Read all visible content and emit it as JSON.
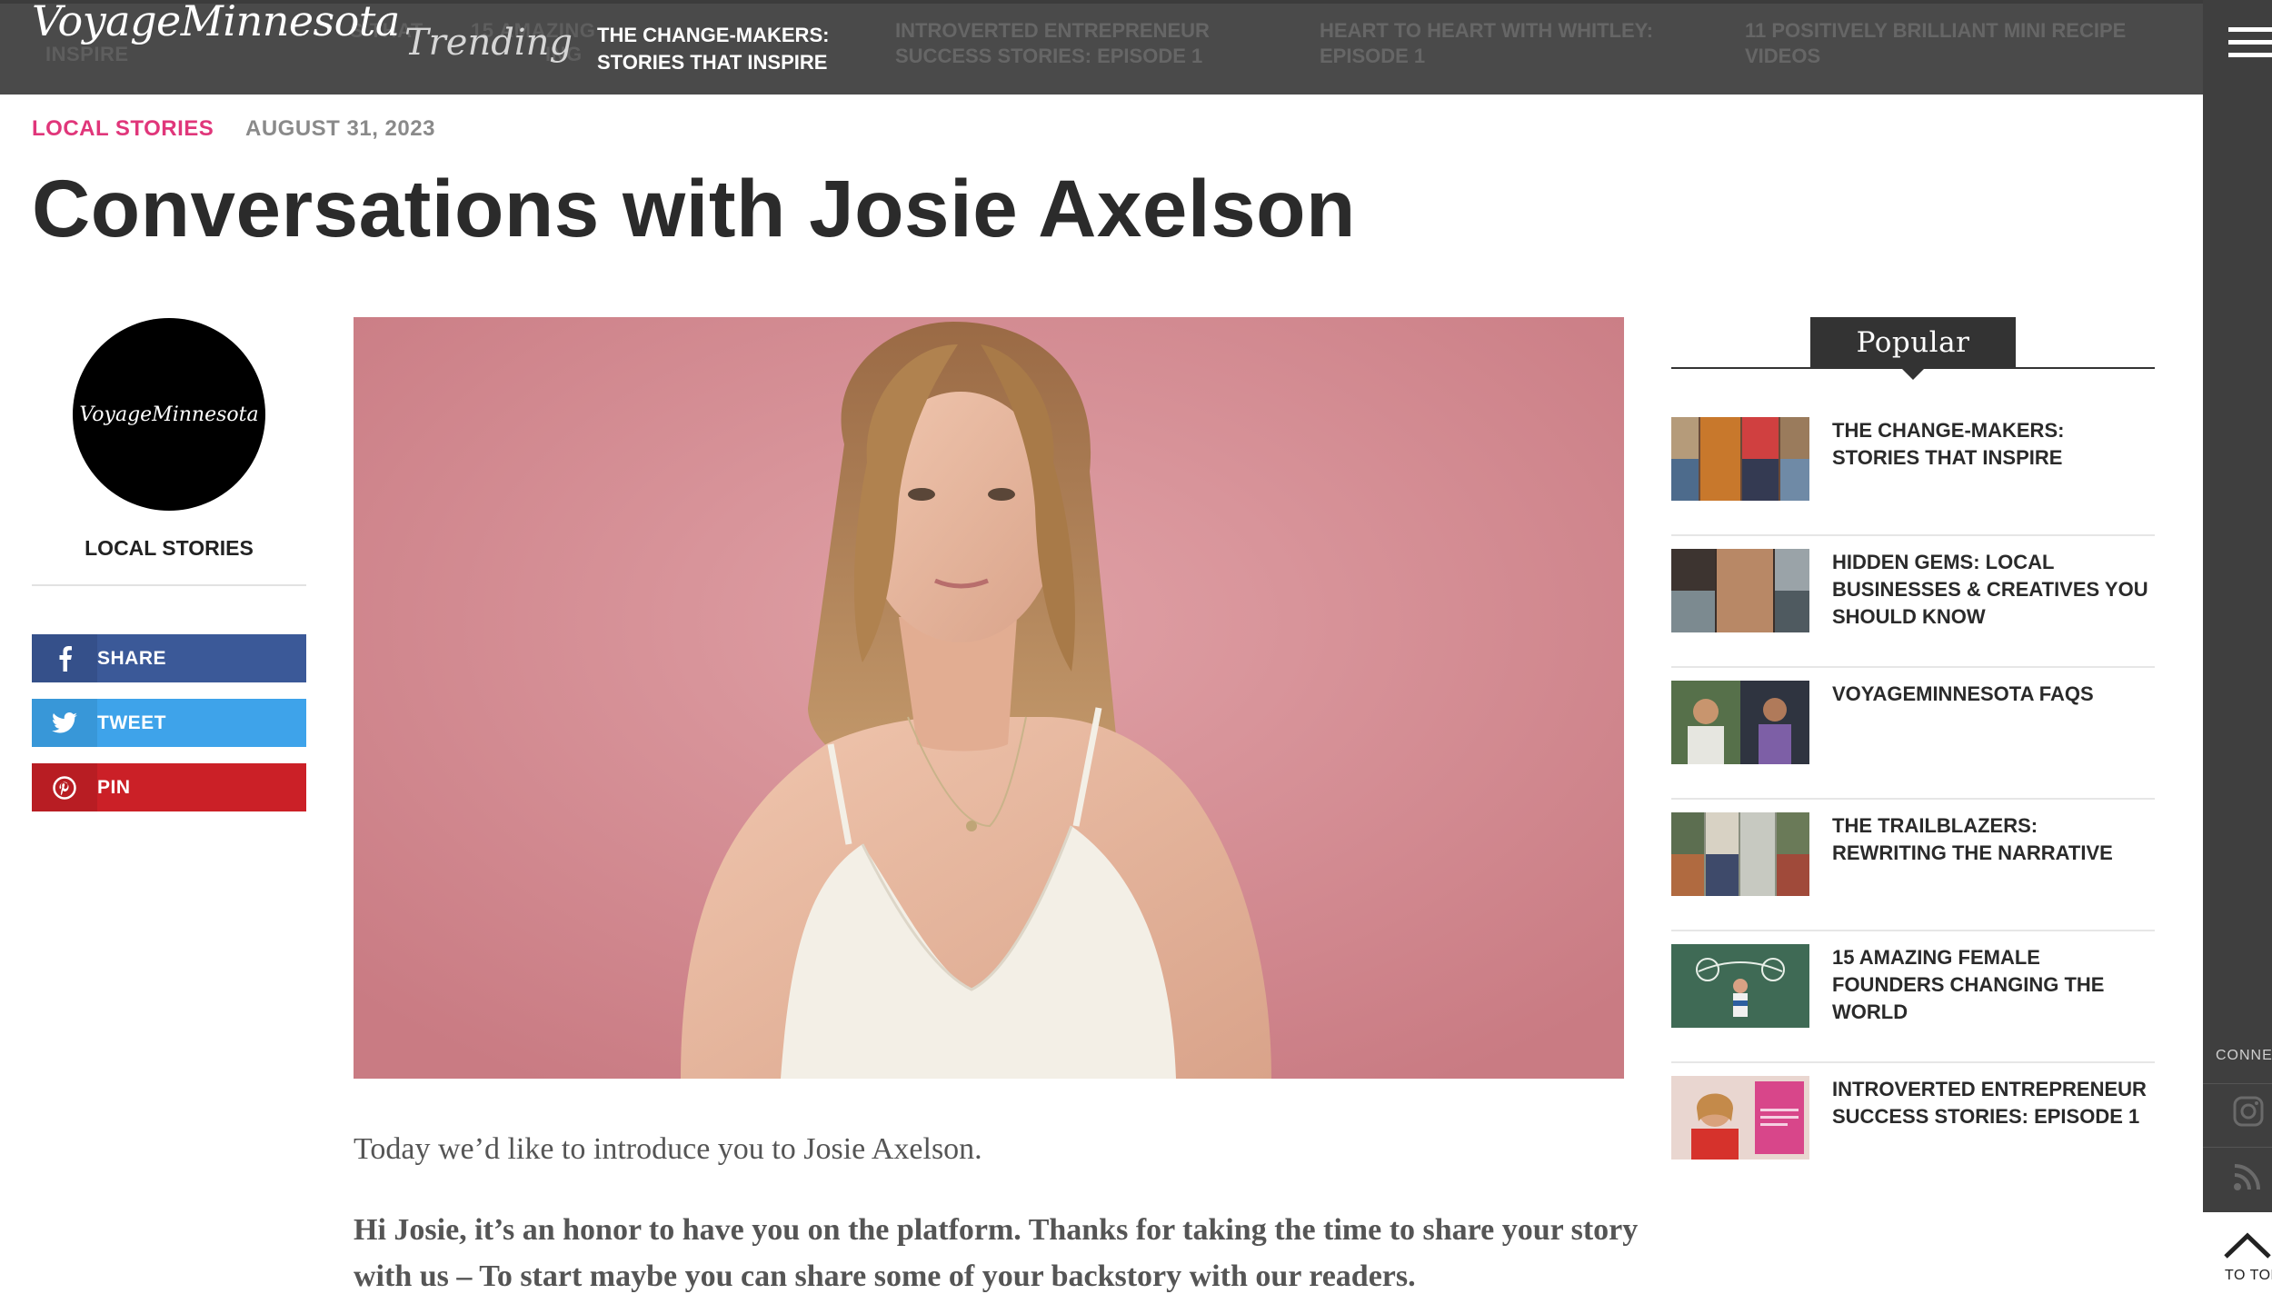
{
  "site": {
    "logo": "VoyageMinnesota",
    "trending_label": "Trending"
  },
  "ticker": {
    "active": "The Change-Makers: Stories That Inspire",
    "items": [
      "Introverted Entrepreneur Success Stories: Episode 1",
      "Heart to Heart with Whitley: Episode 1",
      "11 Positively Brilliant Mini Recipe Videos"
    ],
    "ghost_left": [
      "Inspire",
      "S That",
      "15 Amazing",
      "ing"
    ]
  },
  "article": {
    "category": "Local Stories",
    "date": "August 31, 2023",
    "title": "Conversations with Josie Axelson",
    "intro": "Today we’d like to introduce you to Josie Axelson.",
    "question": "Hi Josie, it’s an honor to have you on the platform. Thanks for taking the time to share your story with us – To start maybe you can share some of your backstory with our readers."
  },
  "author": {
    "avatar_text": "VoyageMinnesota",
    "category": "Local Stories"
  },
  "share": {
    "facebook": "Share",
    "twitter": "Tweet",
    "pinterest": "Pin"
  },
  "popular": {
    "heading": "Popular",
    "items": [
      {
        "title": "The Change-Makers: Stories That Inspire"
      },
      {
        "title": "Hidden Gems: Local Businesses & Creatives You Should Know"
      },
      {
        "title": "VoyageMinnesota FAQs"
      },
      {
        "title": "The Trailblazers: Rewriting the Narrative"
      },
      {
        "title": "15 Amazing Female Founders Changing the World"
      },
      {
        "title": "Introverted Entrepreneur Success Stories: Episode 1"
      }
    ]
  },
  "rail": {
    "connect": "CONNECT",
    "to_top": "TO TOP"
  },
  "colors": {
    "category_accent": "#e0367a",
    "facebook": "#3b5998",
    "twitter": "#3ea3ea",
    "pinterest": "#cb2027",
    "topbar": "#4a4a4a"
  }
}
